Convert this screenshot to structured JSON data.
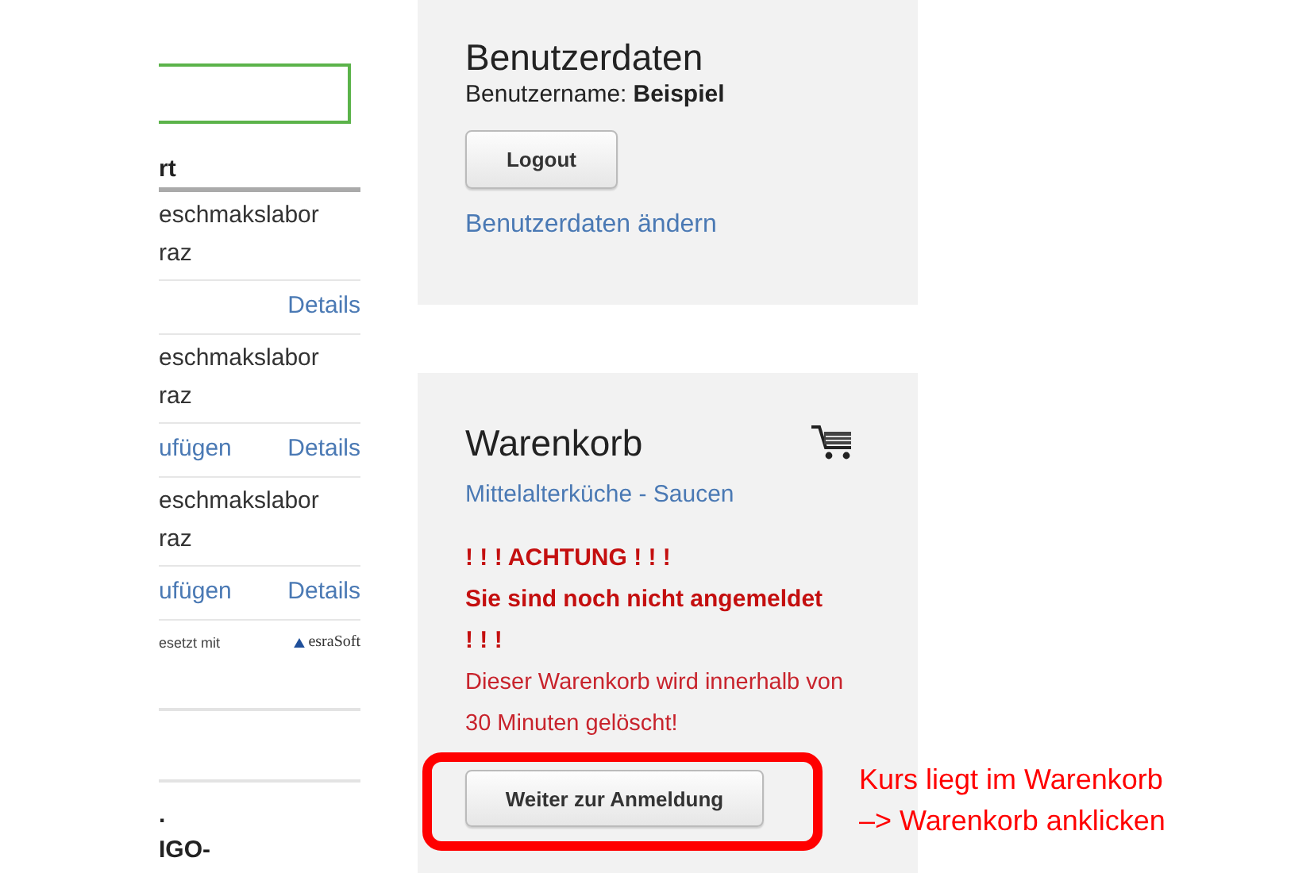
{
  "course_list": {
    "column_header": "rt",
    "rows": [
      {
        "location_lines": [
          "eschmakslabor",
          "raz"
        ],
        "actions": [
          {
            "label": "Details"
          }
        ]
      },
      {
        "location_lines": [
          "eschmakslabor",
          "raz"
        ],
        "actions": [
          {
            "label": "ufügen"
          },
          {
            "label": "Details"
          }
        ]
      },
      {
        "location_lines": [
          "eschmakslabor",
          "raz"
        ],
        "actions": [
          {
            "label": "ufügen"
          },
          {
            "label": "Details"
          }
        ]
      }
    ],
    "footer": {
      "text": "esetzt mit",
      "brand": "esraSoft"
    },
    "below_lines": [
      ".",
      "IGO-"
    ]
  },
  "user_panel": {
    "title": "Benutzerdaten",
    "username_label": "Benutzername:",
    "username": "Beispiel",
    "logout_button": "Logout",
    "edit_link": "Benutzerdaten ändern"
  },
  "cart_panel": {
    "title": "Warenkorb",
    "item": "Mittelalterküche - Saucen",
    "warning_lines": [
      "! ! ! ACHTUNG ! ! !",
      "Sie sind noch nicht angemeldet",
      "! ! !"
    ],
    "notice": "Dieser Warenkorb wird innerhalb von 30 Minuten gelöscht!",
    "continue_button": "Weiter zur Anmeldung"
  },
  "annotation": {
    "lines": [
      "Kurs liegt im Warenkorb",
      "–> Warenkorb anklicken"
    ]
  }
}
